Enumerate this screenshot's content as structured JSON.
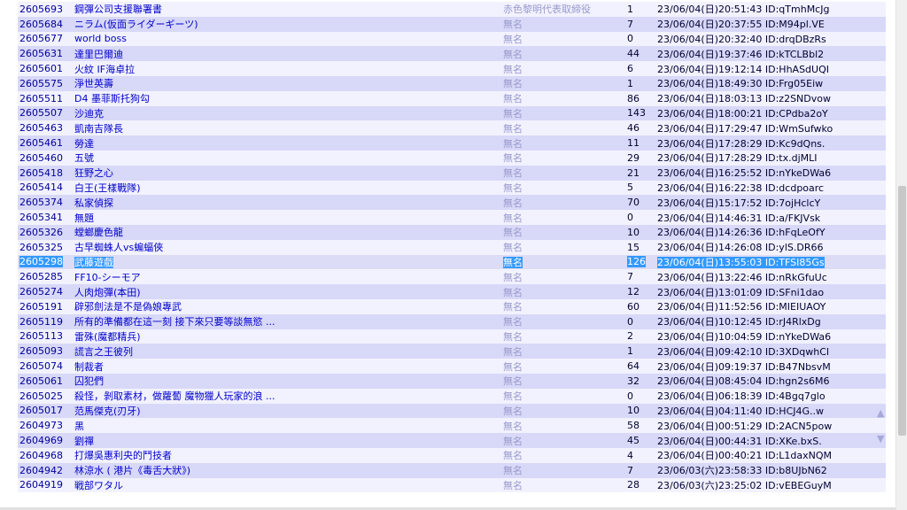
{
  "rows": [
    {
      "no": "2605693",
      "title": "鋼彈公司支援聯署書",
      "author": "赤色黎明代表取締役",
      "replies": "1",
      "date": "23/06/04(日)20:51:43 ID:qTmhMcJg"
    },
    {
      "no": "2605684",
      "title": "ニラム(仮面ライダーギーツ)",
      "author": "無名",
      "replies": "7",
      "date": "23/06/04(日)20:37:55 ID:M94pl.VE"
    },
    {
      "no": "2605677",
      "title": "world boss",
      "author": "無名",
      "replies": "0",
      "date": "23/06/04(日)20:32:40 ID:drqDBzRs"
    },
    {
      "no": "2605631",
      "title": "達里巴爾迪",
      "author": "無名",
      "replies": "44",
      "date": "23/06/04(日)19:37:46 ID:kTCLBbl2"
    },
    {
      "no": "2605601",
      "title": "火紋 IF海卓拉",
      "author": "無名",
      "replies": "6",
      "date": "23/06/04(日)19:12:14 ID:HhASdUQI"
    },
    {
      "no": "2605575",
      "title": "淨世英壽",
      "author": "無名",
      "replies": "1",
      "date": "23/06/04(日)18:49:30 ID:Frg05Eiw"
    },
    {
      "no": "2605511",
      "title": "D4 墨菲斯托狗勾",
      "author": "無名",
      "replies": "86",
      "date": "23/06/04(日)18:03:13 ID:z2SNDvow"
    },
    {
      "no": "2605507",
      "title": "沙迪克",
      "author": "無名",
      "replies": "143",
      "date": "23/06/04(日)18:00:21 ID:CPdba2oY"
    },
    {
      "no": "2605463",
      "title": "凱南吉隊長",
      "author": "無名",
      "replies": "46",
      "date": "23/06/04(日)17:29:47 ID:WmSufwko"
    },
    {
      "no": "2605461",
      "title": "勞達",
      "author": "無名",
      "replies": "11",
      "date": "23/06/04(日)17:28:29 ID:Kc9dQns."
    },
    {
      "no": "2605460",
      "title": "五號",
      "author": "無名",
      "replies": "29",
      "date": "23/06/04(日)17:28:29 ID:tx.djMLI"
    },
    {
      "no": "2605418",
      "title": "狂野之心",
      "author": "無名",
      "replies": "21",
      "date": "23/06/04(日)16:25:52 ID:nYkeDWa6"
    },
    {
      "no": "2605414",
      "title": "白王(王樣戰隊)",
      "author": "無名",
      "replies": "5",
      "date": "23/06/04(日)16:22:38 ID:dcdpoarc"
    },
    {
      "no": "2605374",
      "title": "私家偵探",
      "author": "無名",
      "replies": "70",
      "date": "23/06/04(日)15:17:52 ID:7ojHclcY"
    },
    {
      "no": "2605341",
      "title": "無題",
      "author": "無名",
      "replies": "0",
      "date": "23/06/04(日)14:46:31 ID:a/FKJVsk"
    },
    {
      "no": "2605326",
      "title": "螳螂慶色龍",
      "author": "無名",
      "replies": "10",
      "date": "23/06/04(日)14:26:36 ID:hFqLeOfY"
    },
    {
      "no": "2605325",
      "title": "古早蜘蛛人vs蝙蝠俠",
      "author": "無名",
      "replies": "15",
      "date": "23/06/04(日)14:26:08 ID:ylS.DR66"
    },
    {
      "no": "2605298",
      "title": "武藤遊戲",
      "author": "無名",
      "replies": "126",
      "date": "23/06/04(日)13:55:03 ID:TFSI85Gs",
      "selected": true
    },
    {
      "no": "2605285",
      "title": "FF10-シーモア",
      "author": "無名",
      "replies": "7",
      "date": "23/06/04(日)13:22:46 ID:nRkGfuUc"
    },
    {
      "no": "2605274",
      "title": "人肉炮彈(本田)",
      "author": "無名",
      "replies": "12",
      "date": "23/06/04(日)13:01:09 ID:SFni1dao"
    },
    {
      "no": "2605191",
      "title": "辟邪劍法是不是偽娘專武",
      "author": "無名",
      "replies": "60",
      "date": "23/06/04(日)11:52:56 ID:MIEIUAOY"
    },
    {
      "no": "2605119",
      "title": "所有的準備都在這一刻 接下來只要等談無慾 ...",
      "author": "無名",
      "replies": "0",
      "date": "23/06/04(日)10:12:45 ID:rJ4RlxDg"
    },
    {
      "no": "2605113",
      "title": "雷殊(魔都精兵)",
      "author": "無名",
      "replies": "2",
      "date": "23/06/04(日)10:04:59 ID:nYkeDWa6"
    },
    {
      "no": "2605093",
      "title": "謊言之王彼列",
      "author": "無名",
      "replies": "1",
      "date": "23/06/04(日)09:42:10 ID:3XDqwhCl"
    },
    {
      "no": "2605074",
      "title": "制裁者",
      "author": "無名",
      "replies": "64",
      "date": "23/06/04(日)09:19:37 ID:B47NbsvM"
    },
    {
      "no": "2605061",
      "title": "囚犯們",
      "author": "無名",
      "replies": "32",
      "date": "23/06/04(日)08:45:04 ID:hgn2s6M6"
    },
    {
      "no": "2605025",
      "title": "殺怪，剝取素材，做蘿蔔 魔物獵人玩家的浪 ...",
      "author": "無名",
      "replies": "0",
      "date": "23/06/04(日)06:18:39 ID:4Bgq7glo"
    },
    {
      "no": "2605017",
      "title": "范馬傑克(刃牙)",
      "author": "無名",
      "replies": "10",
      "date": "23/06/04(日)04:11:40 ID:HCJ4G..w"
    },
    {
      "no": "2604973",
      "title": "黑",
      "author": "無名",
      "replies": "58",
      "date": "23/06/04(日)00:51:29 ID:2ACN5pow"
    },
    {
      "no": "2604969",
      "title": "劉禪",
      "author": "無名",
      "replies": "45",
      "date": "23/06/04(日)00:44:31 ID:XKe.bxS."
    },
    {
      "no": "2604968",
      "title": "打爆吳惠利央的鬥技者",
      "author": "無名",
      "replies": "4",
      "date": "23/06/04(日)00:40:21 ID:L1daxNQM"
    },
    {
      "no": "2604942",
      "title": "林涼水 ( 港片《毒舌大狀》)",
      "author": "無名",
      "replies": "7",
      "date": "23/06/03(六)23:58:33 ID:b8UJbN62"
    },
    {
      "no": "2604919",
      "title": "戦部ワタル",
      "author": "無名",
      "replies": "28",
      "date": "23/06/03(六)23:25:02 ID:vEBEGuyM"
    }
  ],
  "nav": {
    "up": "▲",
    "down": "▼"
  }
}
